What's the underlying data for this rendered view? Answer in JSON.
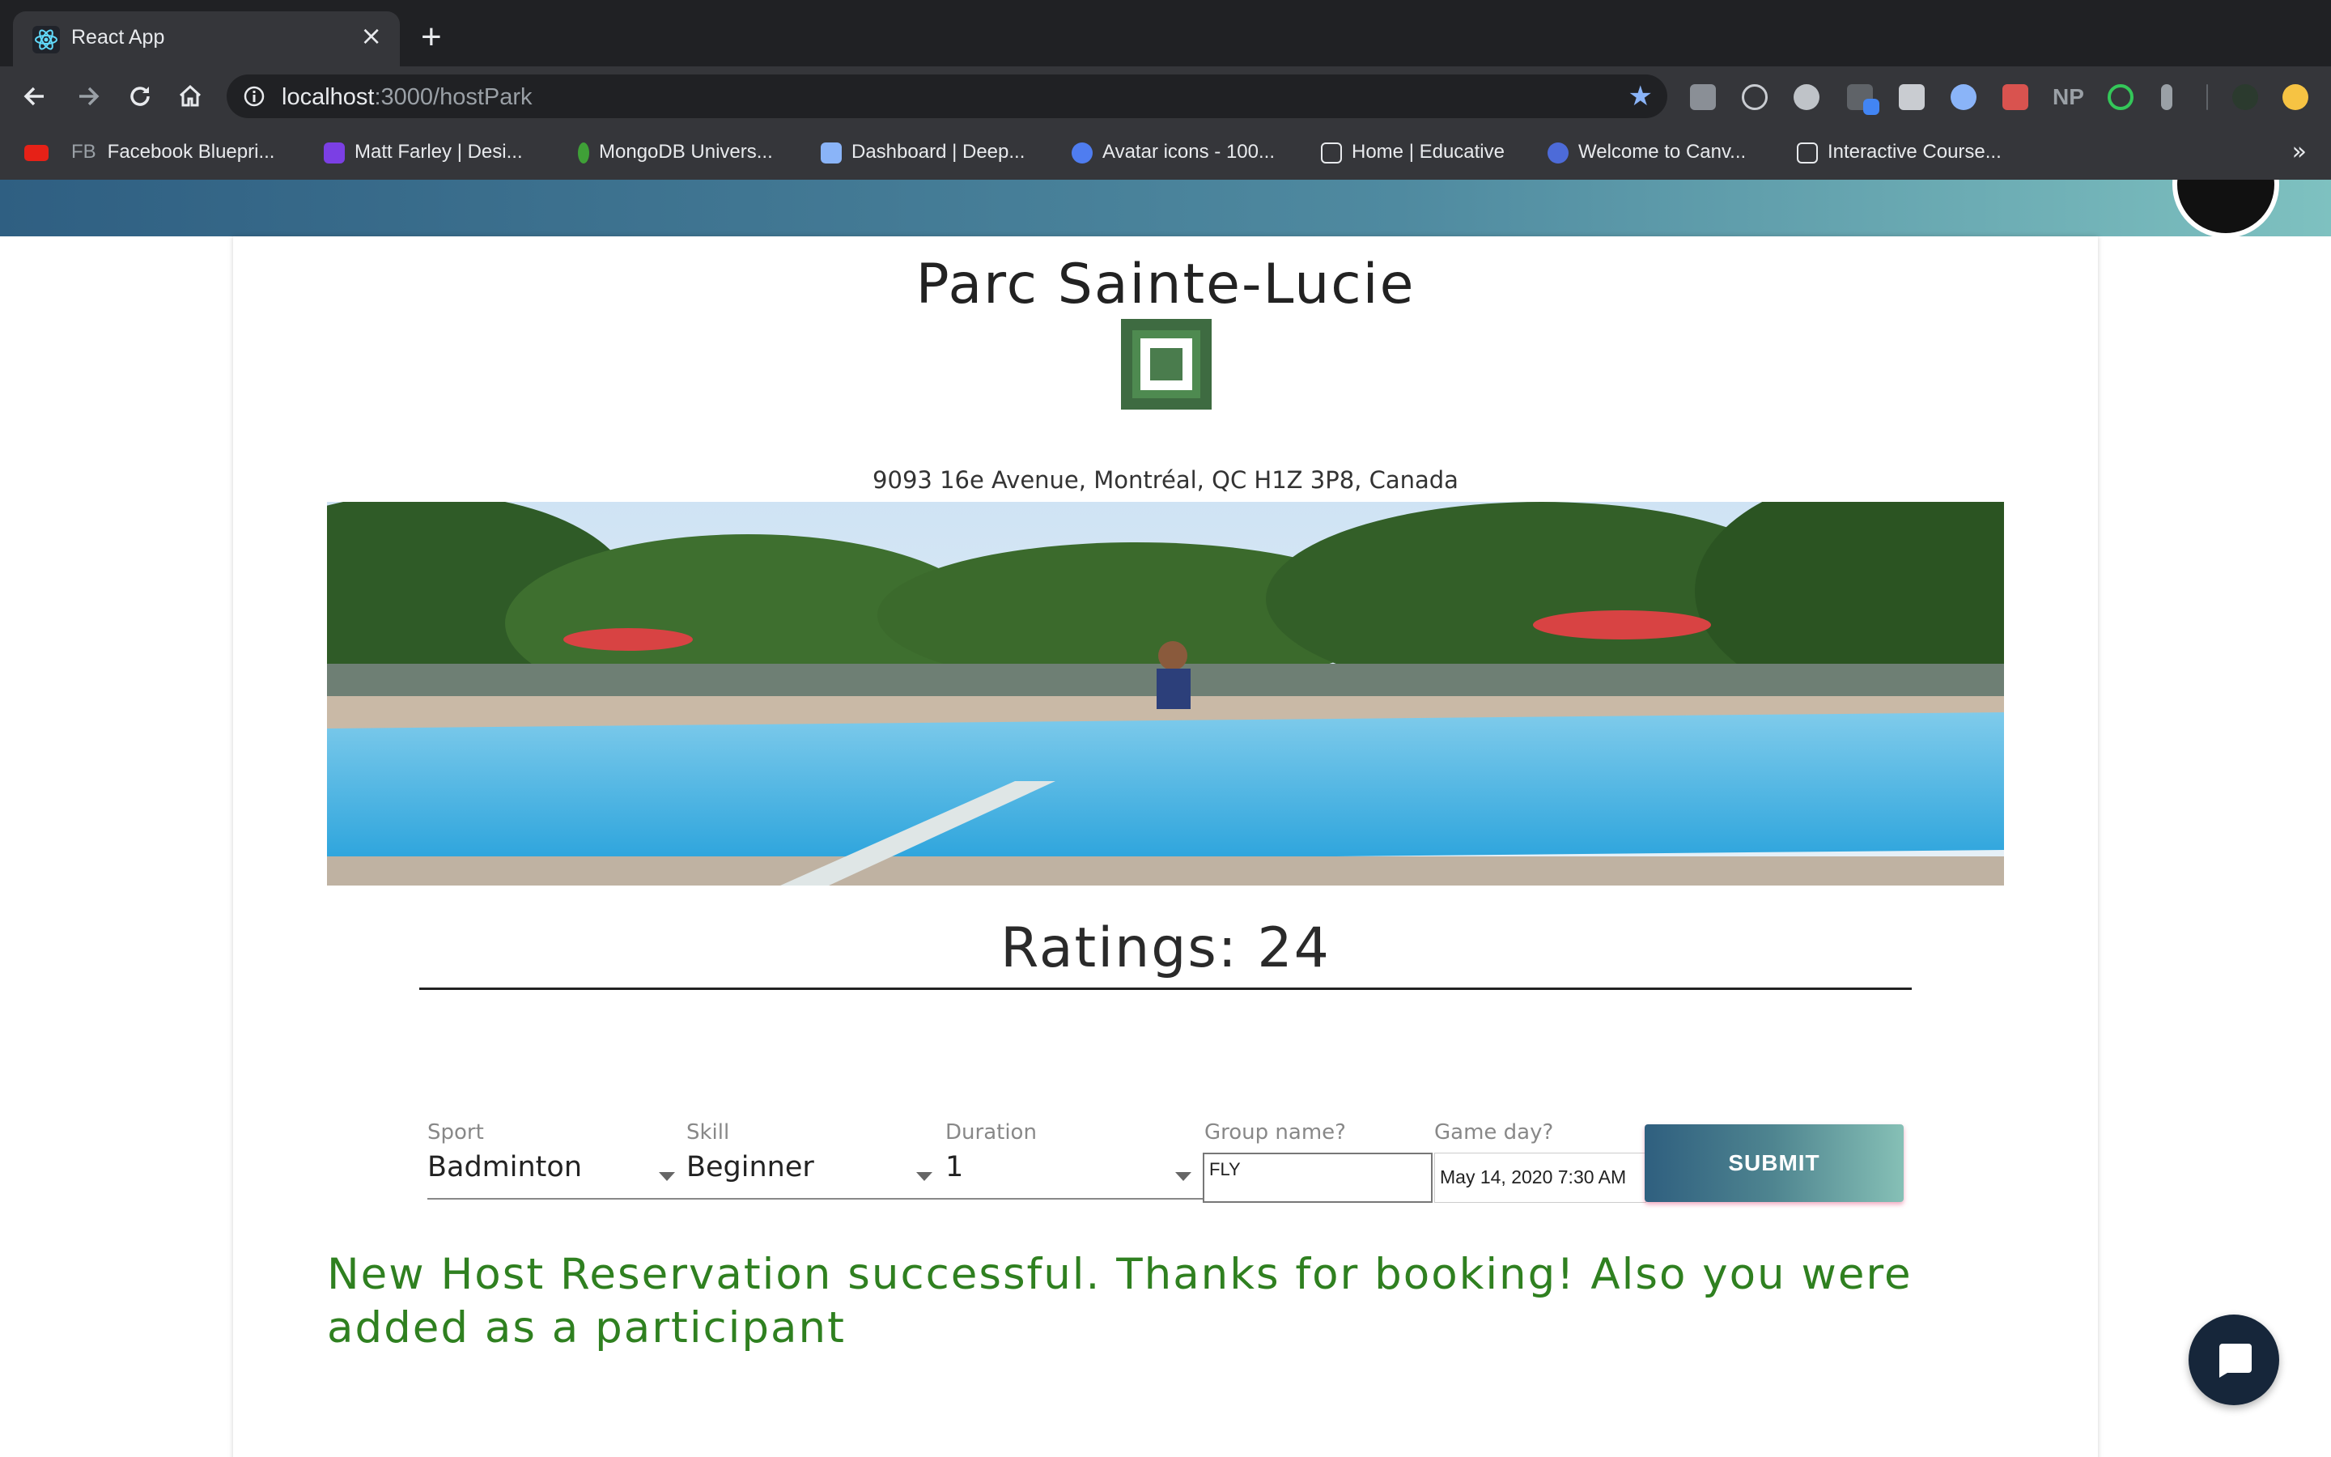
{
  "browser": {
    "tab_title": "React App",
    "tab_close": "×",
    "new_tab": "+",
    "url_host": "localhost",
    "url_path": ":3000/hostPark",
    "bookmarks": [
      {
        "label": "Facebook Bluepri...",
        "prefix": "FB"
      },
      {
        "label": "Matt Farley | Desi..."
      },
      {
        "label": "MongoDB Univers..."
      },
      {
        "label": "Dashboard | Deep..."
      },
      {
        "label": "Avatar icons - 100..."
      },
      {
        "label": "Home | Educative"
      },
      {
        "label": "Welcome to Canv..."
      },
      {
        "label": "Interactive Course..."
      }
    ],
    "bookmarks_more": "»",
    "extension_text": "NP"
  },
  "park": {
    "name": "Parc Sainte-Lucie",
    "address": "9093 16e Avenue, Montréal, QC H1Z 3P8, Canada",
    "ratings": "Ratings: 24"
  },
  "form": {
    "sport_label": "Sport",
    "sport_value": "Badminton",
    "skill_label": "Skill",
    "skill_value": "Beginner",
    "duration_label": "Duration",
    "duration_value": "1",
    "group_label": "Group name?",
    "group_value": "FLY",
    "gameday_label": "Game day?",
    "gameday_value": "May 14, 2020 7:30 AM",
    "submit_label": "SUBMIT"
  },
  "status_message": "New Host Reservation successful. Thanks for booking! Also you were added as a participant",
  "colors": {
    "success": "#2f8020",
    "header_gradient_start": "#2f5f82",
    "header_gradient_end": "#7ec1c0"
  }
}
